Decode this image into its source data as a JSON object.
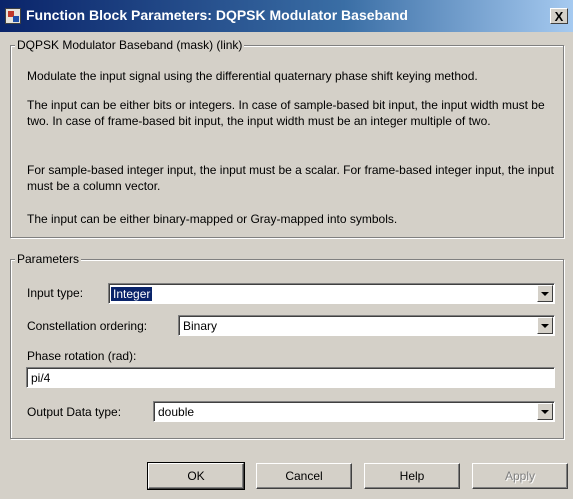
{
  "window": {
    "title": "Function Block Parameters: DQPSK Modulator Baseband",
    "close_label": "X"
  },
  "mask": {
    "legend": "DQPSK Modulator Baseband (mask) (link)",
    "description": [
      "Modulate the input signal using the differential quaternary phase shift keying method.",
      "The input can be either bits or integers. In case of sample-based bit input, the input width must be two. In case of frame-based bit input, the input width must be an integer multiple of two.",
      "For sample-based integer input, the input must be a scalar. For frame-based integer input, the input must be a column vector.",
      "The input can be either binary-mapped or Gray-mapped into symbols."
    ]
  },
  "parameters": {
    "legend": "Parameters",
    "input_type": {
      "label": "Input type:",
      "value": "Integer"
    },
    "constellation_ordering": {
      "label": "Constellation ordering:",
      "value": "Binary"
    },
    "phase_rotation": {
      "label": "Phase rotation (rad):",
      "value": "pi/4"
    },
    "output_data_type": {
      "label": "Output Data type:",
      "value": "double"
    }
  },
  "buttons": {
    "ok": "OK",
    "cancel": "Cancel",
    "help": "Help",
    "apply": "Apply"
  }
}
